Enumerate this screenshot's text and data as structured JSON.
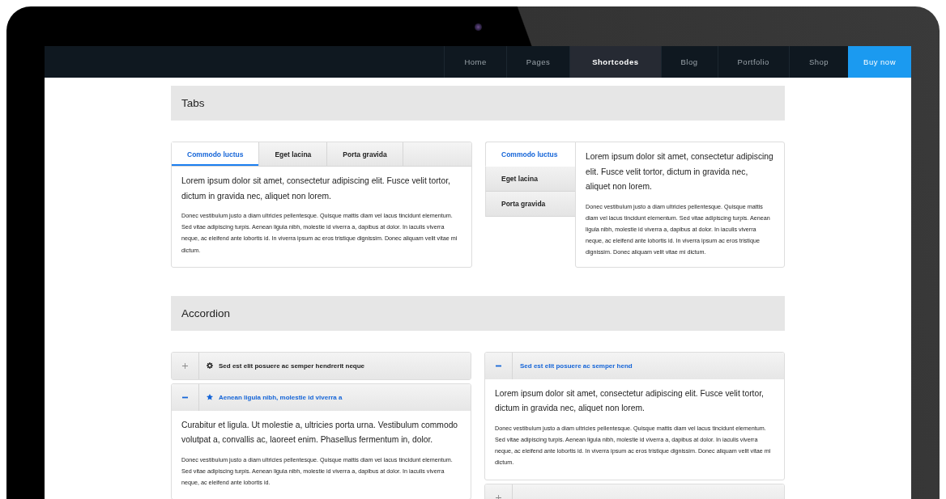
{
  "nav": {
    "items": [
      {
        "label": "Home",
        "selected": false
      },
      {
        "label": "Pages",
        "selected": false
      },
      {
        "label": "Shortcodes",
        "selected": true
      },
      {
        "label": "Blog",
        "selected": false
      },
      {
        "label": "Portfolio",
        "selected": false
      },
      {
        "label": "Shop",
        "selected": false
      }
    ],
    "cta": "Buy now"
  },
  "tabs_section": {
    "title": "Tabs",
    "horizontal": {
      "tabs": [
        {
          "label": "Commodo luctus",
          "selected": true
        },
        {
          "label": "Eget lacina",
          "selected": false
        },
        {
          "label": "Porta gravida",
          "selected": false
        }
      ],
      "lead": "Lorem ipsum dolor sit amet, consectetur adipiscing elit. Fusce velit tortor, dictum in gravida nec, aliquet non lorem.",
      "body": "Donec vestibulum justo a diam ultricies pellentesque. Quisque mattis diam vel lacus tincidunt elementum. Sed vitae adipiscing turpis. Aenean ligula nibh, molestie id viverra a, dapibus at dolor. In iaculis viverra neque, ac eleifend ante lobortis id. In viverra ipsum ac eros tristique dignissim. Donec aliquam velit vitae mi dictum."
    },
    "vertical": {
      "tabs": [
        {
          "label": "Commodo luctus",
          "selected": true
        },
        {
          "label": "Eget lacina",
          "selected": false
        },
        {
          "label": "Porta gravida",
          "selected": false
        }
      ],
      "lead": "Lorem ipsum dolor sit amet, consectetur adipiscing elit. Fusce velit tortor, dictum in gravida nec, aliquet non lorem.",
      "body": "Donec vestibulum justo a diam ultricies pellentesque. Quisque mattis diam vel lacus tincidunt elementum. Sed vitae adipiscing turpis. Aenean ligula nibh, molestie id viverra a, dapibus at dolor. In iaculis viverra neque, ac eleifend ante lobortis id. In viverra ipsum ac eros tristique dignissim. Donec aliquam velit vitae mi dictum."
    }
  },
  "accordion_section": {
    "title": "Accordion",
    "left": [
      {
        "kind": "gear",
        "title": "Sed est elit posuere ac semper hendrerit neque",
        "expanded": false
      },
      {
        "kind": "star",
        "title": "Aenean ligula nibh, molestie id viverra a",
        "expanded": true,
        "lead": "Curabitur et ligula. Ut molestie a, ultricies porta urna. Vestibulum commodo volutpat a, convallis ac, laoreet enim. Phasellus fermentum in, dolor.",
        "body": "Donec vestibulum justo a diam ultricies pellentesque. Quisque mattis diam vel lacus tincidunt elementum. Sed vitae adipiscing turpis. Aenean ligula nibh, molestie id viverra a, dapibus at dolor. In iaculis viverra neque, ac eleifend ante lobortis id."
      }
    ],
    "right": [
      {
        "title": "Sed est elit posuere ac semper hend",
        "expanded": true,
        "lead": "Lorem ipsum dolor sit amet, consectetur adipiscing elit. Fusce velit tortor, dictum in gravida nec, aliquet non lorem.",
        "body": "Donec vestibulum justo a diam ultricies pellentesque. Quisque mattis diam vel lacus tincidunt elementum. Sed vitae adipiscing turpis. Aenean ligula nibh, molestie id viverra a, dapibus at dolor. In iaculis viverra neque, ac eleifend ante lobortis id. In viverra ipsum ac eros tristique dignissim. Donec aliquam velit vitae mi dictum."
      },
      {
        "expanded": false
      }
    ]
  }
}
